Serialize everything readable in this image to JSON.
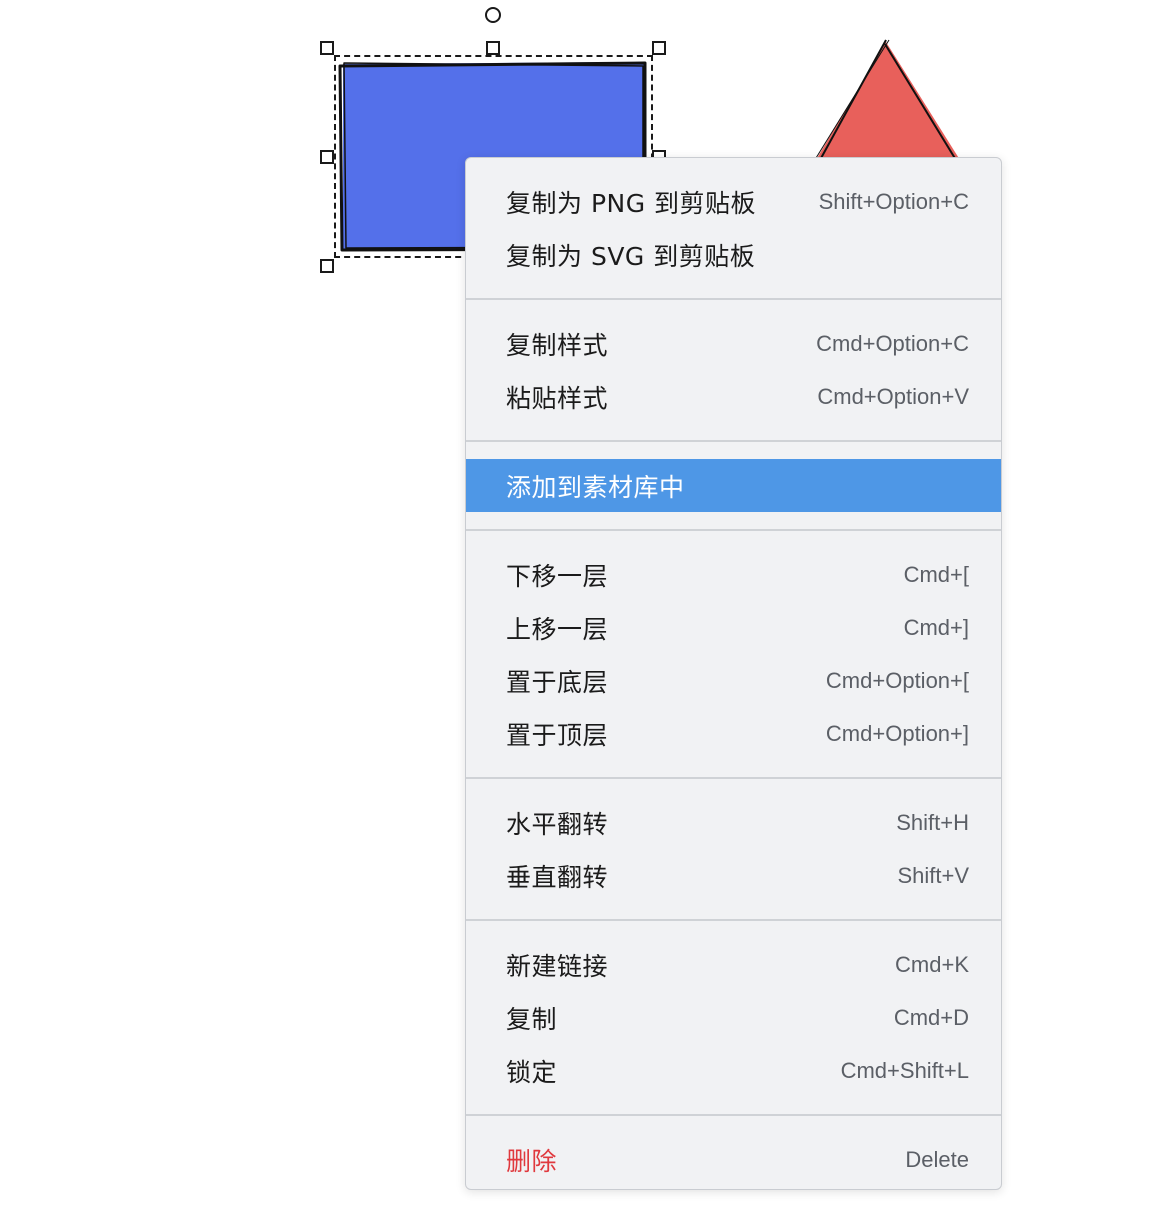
{
  "colors": {
    "rect_fill": "#5470ea",
    "triangle_fill": "#e8605b",
    "highlight": "#4e97e6",
    "danger": "#e0393e"
  },
  "context_menu": {
    "groups": [
      [
        {
          "label": "复制为 PNG 到剪贴板",
          "shortcut": "Shift+Option+C"
        },
        {
          "label": "复制为 SVG 到剪贴板",
          "shortcut": ""
        }
      ],
      [
        {
          "label": "复制样式",
          "shortcut": "Cmd+Option+C"
        },
        {
          "label": "粘贴样式",
          "shortcut": "Cmd+Option+V"
        }
      ],
      [
        {
          "label": "添加到素材库中",
          "shortcut": ""
        }
      ],
      [
        {
          "label": "下移一层",
          "shortcut": "Cmd+["
        },
        {
          "label": "上移一层",
          "shortcut": "Cmd+]"
        },
        {
          "label": "置于底层",
          "shortcut": "Cmd+Option+["
        },
        {
          "label": "置于顶层",
          "shortcut": "Cmd+Option+]"
        }
      ],
      [
        {
          "label": "水平翻转",
          "shortcut": "Shift+H"
        },
        {
          "label": "垂直翻转",
          "shortcut": "Shift+V"
        }
      ],
      [
        {
          "label": "新建链接",
          "shortcut": "Cmd+K"
        },
        {
          "label": "复制",
          "shortcut": "Cmd+D"
        },
        {
          "label": "锁定",
          "shortcut": "Cmd+Shift+L"
        }
      ],
      [
        {
          "label": "删除",
          "shortcut": "Delete"
        }
      ]
    ]
  }
}
